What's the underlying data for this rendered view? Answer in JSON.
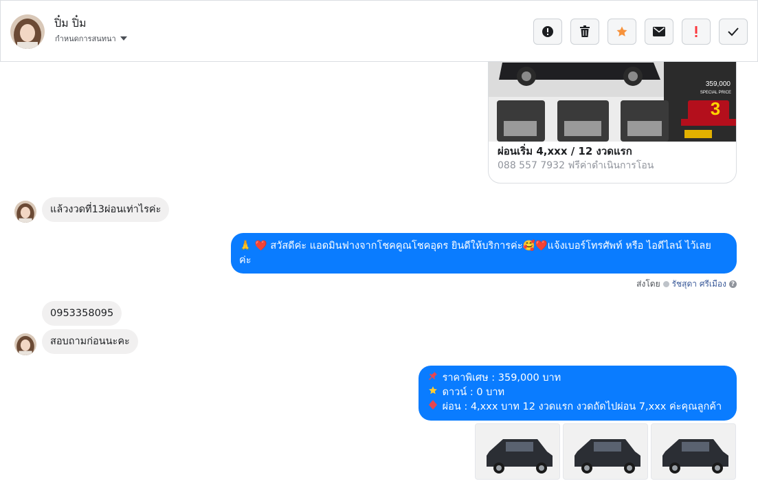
{
  "header": {
    "contact_name": "ปิ๋ม ปิ๋ม",
    "subtitle": "กำหนดการสนทนา"
  },
  "toolbar": [
    {
      "name": "report-button",
      "icon": "alert-circle-icon"
    },
    {
      "name": "delete-button",
      "icon": "trash-icon"
    },
    {
      "name": "star-button",
      "icon": "star-icon"
    },
    {
      "name": "mark-unread-button",
      "icon": "envelope-icon"
    },
    {
      "name": "important-button",
      "icon": "exclamation-icon"
    },
    {
      "name": "done-button",
      "icon": "check-icon"
    }
  ],
  "card": {
    "title": "ผ่อนเริ่ม 4,xxx / 12 งวดแรก",
    "subtitle": "088 557 7932 ฟรีค่าดำเนินการโอน",
    "price_badge": "359,000",
    "special_price": "SPECIAL PRICE",
    "months_number": "3"
  },
  "messages": {
    "in_1": "แล้วงวดที่13ผ่อนเท่าไรค่ะ",
    "out_1_line1": "🙏 ❤️ สวัสดีค่ะ แอดมินฟางจากโชคคูณโชคอุดร ยินดีให้บริการค่ะ🥰❤️แจ้งเบอร์โทรศัพท์ หรือ ไอดีไลน์  ไว้เลย",
    "out_1_line2": "ค่ะ",
    "sent_by_label": "ส่งโดย",
    "sent_by_name": "รัชสุดา ศรีเมือง",
    "in_2": "0953358095",
    "in_3": "สอบถามก่อนนะคะ",
    "out_2_line1": "ราคาพิเศษ : 359,000 บาท",
    "out_2_line2": "ดาวน์ : 0 บาท",
    "out_2_line3": "ผ่อน : 4,xxx บาท 12 งวดแรก   งวดถัดไปผ่อน 7,xxx ค่ะคุณลูกค้า"
  },
  "colors": {
    "outgoing": "#0a7cff",
    "incoming": "#f1f0f0",
    "star": "#f7923b",
    "important": "#fa383e"
  }
}
